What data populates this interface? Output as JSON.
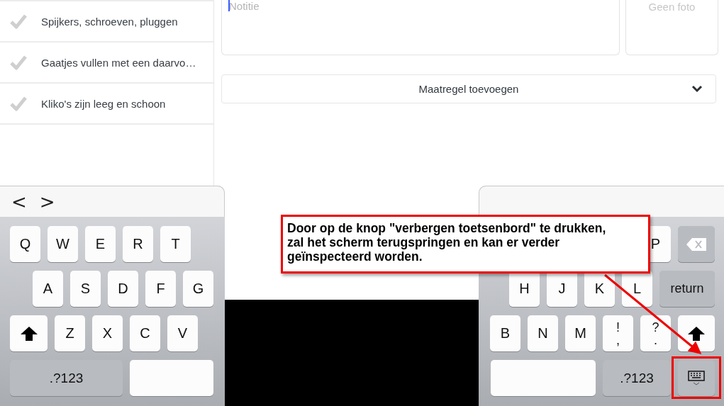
{
  "checklist": [
    {
      "label": "Spijkers, schroeven, pluggen"
    },
    {
      "label": "Gaatjes vullen met een daarvo…"
    },
    {
      "label": "Kliko's zijn leeg en schoon"
    }
  ],
  "note": {
    "placeholder": "Notitie",
    "focused": true
  },
  "photo": {
    "label": "Geen foto"
  },
  "dropdown": {
    "label": "Maatregel toevoegen"
  },
  "keyboard_left": {
    "nav": [
      "<",
      ">"
    ],
    "rows": [
      [
        {
          "kind": "letter",
          "label": "Q"
        },
        {
          "kind": "letter",
          "label": "W"
        },
        {
          "kind": "letter",
          "label": "E"
        },
        {
          "kind": "letter",
          "label": "R"
        },
        {
          "kind": "letter",
          "label": "T"
        }
      ],
      [
        {
          "kind": "letter",
          "label": "A"
        },
        {
          "kind": "letter",
          "label": "S"
        },
        {
          "kind": "letter",
          "label": "D"
        },
        {
          "kind": "letter",
          "label": "F"
        },
        {
          "kind": "letter",
          "label": "G"
        }
      ],
      [
        {
          "kind": "shift"
        },
        {
          "kind": "letter",
          "label": "Z"
        },
        {
          "kind": "letter",
          "label": "X"
        },
        {
          "kind": "letter",
          "label": "C"
        },
        {
          "kind": "letter",
          "label": "V"
        }
      ],
      [
        {
          "kind": "mode",
          "label": ".?123"
        },
        {
          "kind": "space"
        }
      ]
    ]
  },
  "keyboard_right": {
    "rows": [
      [
        {
          "kind": "letter",
          "label": "P"
        },
        {
          "kind": "backspace"
        }
      ],
      [
        {
          "kind": "letter",
          "label": "H"
        },
        {
          "kind": "letter",
          "label": "J"
        },
        {
          "kind": "letter",
          "label": "K"
        },
        {
          "kind": "letter",
          "label": "L"
        },
        {
          "kind": "return",
          "label": "return"
        }
      ],
      [
        {
          "kind": "letter",
          "label": "B"
        },
        {
          "kind": "letter",
          "label": "N"
        },
        {
          "kind": "letter",
          "label": "M"
        },
        {
          "kind": "punct",
          "top": "!",
          "bottom": ","
        },
        {
          "kind": "punct",
          "top": "?",
          "bottom": "."
        },
        {
          "kind": "shift"
        }
      ],
      [
        {
          "kind": "space"
        },
        {
          "kind": "mode",
          "label": ".?123"
        },
        {
          "kind": "hide"
        }
      ]
    ]
  },
  "annotation": {
    "text": "Door op de knop \"verbergen toetsenbord\" te drukken, zal het scherm terugspringen en kan er verder geïnspecteerd worden."
  }
}
